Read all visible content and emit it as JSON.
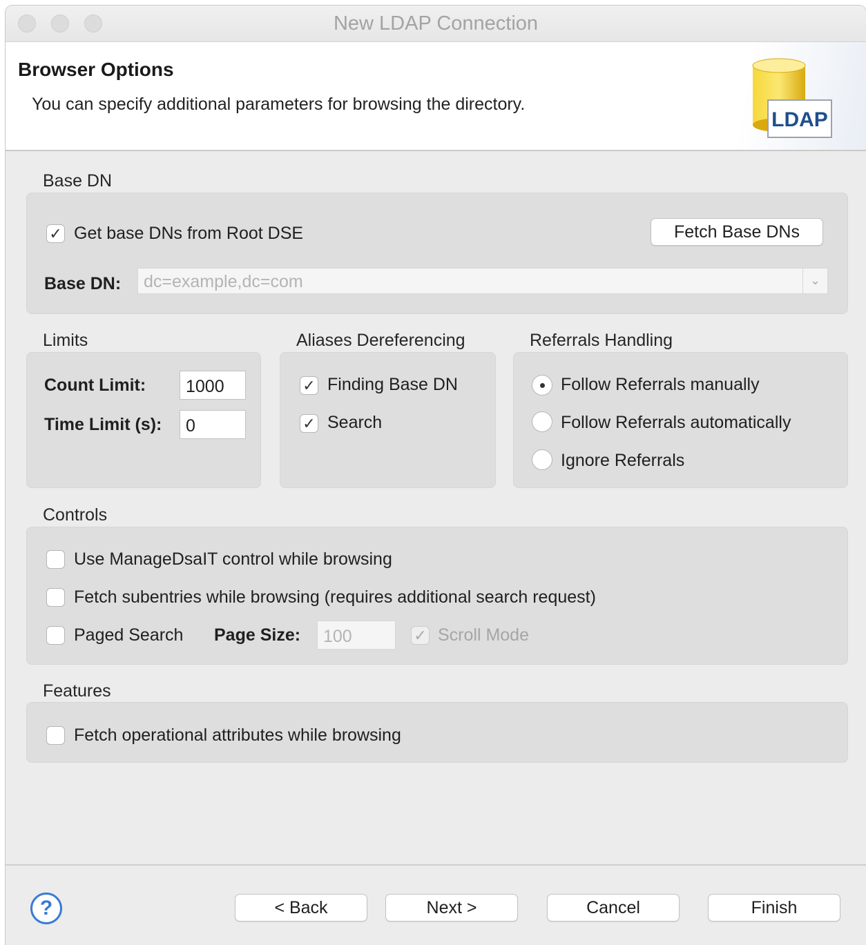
{
  "window": {
    "title": "New LDAP Connection"
  },
  "header": {
    "title": "Browser Options",
    "description": "You can specify additional parameters for browsing the directory.",
    "logo_text": "LDAP"
  },
  "base_dn": {
    "group_label": "Base DN",
    "get_from_root_dse": {
      "label": "Get base DNs from Root DSE",
      "checked": true
    },
    "fetch_button": "Fetch Base DNs",
    "field_label": "Base DN:",
    "field_value": "dc=example,dc=com"
  },
  "limits": {
    "group_label": "Limits",
    "count_label": "Count Limit:",
    "count_value": "1000",
    "time_label": "Time Limit (s):",
    "time_value": "0"
  },
  "aliases": {
    "group_label": "Aliases Dereferencing",
    "finding_base_dn": {
      "label": "Finding Base DN",
      "checked": true
    },
    "search": {
      "label": "Search",
      "checked": true
    }
  },
  "referrals": {
    "group_label": "Referrals Handling",
    "options": [
      {
        "label": "Follow Referrals manually",
        "selected": true
      },
      {
        "label": "Follow Referrals automatically",
        "selected": false
      },
      {
        "label": "Ignore Referrals",
        "selected": false
      }
    ]
  },
  "controls": {
    "group_label": "Controls",
    "manage_dsait": {
      "label": "Use ManageDsaIT control while browsing",
      "checked": false
    },
    "fetch_subentries": {
      "label": "Fetch subentries while browsing (requires additional search request)",
      "checked": false
    },
    "paged_search": {
      "label": "Paged Search",
      "checked": false
    },
    "page_size_label": "Page Size:",
    "page_size_value": "100",
    "scroll_mode": {
      "label": "Scroll Mode",
      "checked": true,
      "disabled": true
    }
  },
  "features": {
    "group_label": "Features",
    "fetch_operational": {
      "label": "Fetch operational attributes while browsing",
      "checked": false
    }
  },
  "buttons": {
    "back": "< Back",
    "next": "Next >",
    "cancel": "Cancel",
    "finish": "Finish"
  },
  "icons": {
    "help": "help-icon",
    "check": "✓",
    "dropdown": "chevron-down-icon"
  },
  "colors": {
    "accent": "#3a7bd5",
    "logo_yellow": "#f2c51a",
    "logo_text": "#1f4e8c"
  }
}
